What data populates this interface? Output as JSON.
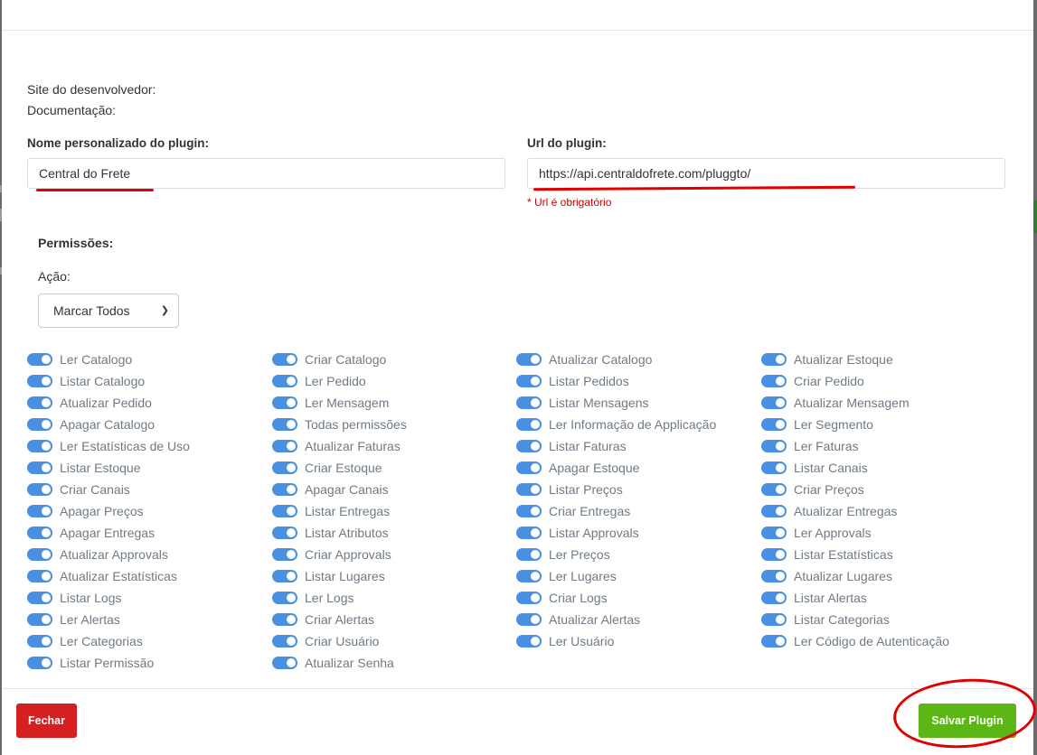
{
  "modal": {
    "developer_site_label": "Site do desenvolvedor:",
    "documentation_label": "Documentação:",
    "plugin_name_label": "Nome personalizado do plugin:",
    "plugin_name_value": "Central do Frete",
    "plugin_url_label": "Url do plugin:",
    "plugin_url_value": "https://api.centraldofrete.com/pluggto/",
    "plugin_url_error": "* Url é obrigatório",
    "permissions_title": "Permissões:",
    "action_label": "Ação:",
    "action_select_value": "Marcar Todos",
    "permissions_columns": [
      [
        "Ler Catalogo",
        "Listar Catalogo",
        "Atualizar Pedido",
        "Apagar Catalogo",
        "Ler Estatísticas de Uso",
        "Listar Estoque",
        "Criar Canais",
        "Apagar Preços",
        "Apagar Entregas",
        "Atualizar Approvals",
        "Atualizar Estatísticas",
        "Listar Logs",
        "Ler Alertas",
        "Ler Categorias",
        "Listar Permissão"
      ],
      [
        "Criar Catalogo",
        "Ler Pedido",
        "Ler Mensagem",
        "Todas permissões",
        "Atualizar Faturas",
        "Criar Estoque",
        "Apagar Canais",
        "Listar Entregas",
        "Listar Atributos",
        "Criar Approvals",
        "Listar Lugares",
        "Ler Logs",
        "Criar Alertas",
        "Criar Usuário",
        "Atualizar Senha"
      ],
      [
        "Atualizar Catalogo",
        "Listar Pedidos",
        "Listar Mensagens",
        "Ler Informação de Applicação",
        "Listar Faturas",
        "Apagar Estoque",
        "Listar Preços",
        "Criar Entregas",
        "Listar Approvals",
        "Ler Preços",
        "Ler Lugares",
        "Criar Logs",
        "Atualizar Alertas",
        "Ler Usuário"
      ],
      [
        "Atualizar Estoque",
        "Criar Pedido",
        "Atualizar Mensagem",
        "Ler Segmento",
        "Ler Faturas",
        "Listar Canais",
        "Criar Preços",
        "Atualizar Entregas",
        "Ler Approvals",
        "Listar Estatísticas",
        "Atualizar Lugares",
        "Listar Alertas",
        "Listar Categorias",
        "Ler Código de Autenticação"
      ]
    ],
    "close_button": "Fechar",
    "save_button": "Salvar Plugin"
  },
  "colors": {
    "toggle_on": "#4a90e2",
    "close_button": "#d42020",
    "save_button": "#5cb615",
    "error_text": "#cc0000",
    "annotation": "#e00000"
  }
}
